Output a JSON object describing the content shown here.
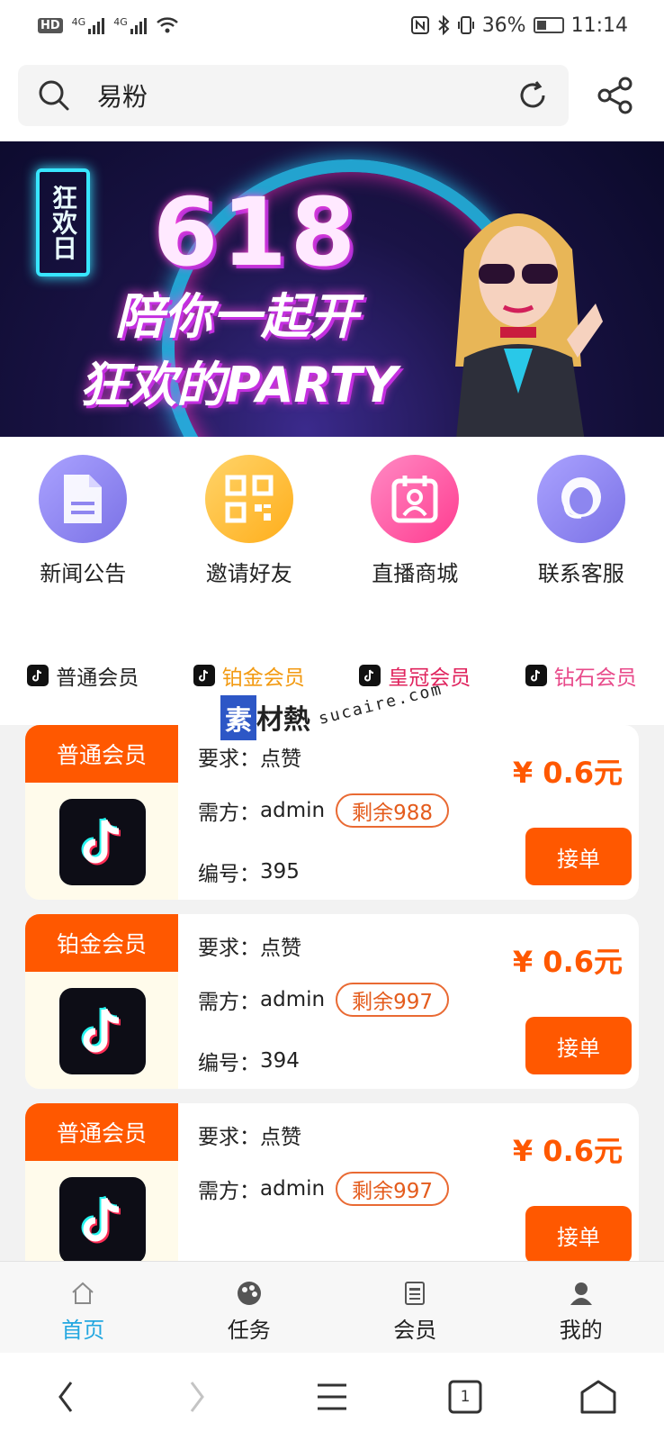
{
  "status": {
    "network1": "4G",
    "network2": "4G",
    "battery": "36%",
    "time": "11:14"
  },
  "search": {
    "text": "易粉"
  },
  "banner": {
    "sign_text": "狂欢日",
    "headline": "618",
    "line1": "陪你一起开",
    "line2": "狂欢的PARTY"
  },
  "quick_nav": [
    {
      "label": "新闻公告",
      "icon": "document-icon",
      "color": "#8f86f0"
    },
    {
      "label": "邀请好友",
      "icon": "qr-code-icon",
      "color": "#ffc03a"
    },
    {
      "label": "直播商城",
      "icon": "calendar-user-icon",
      "color": "#ff5fa8"
    },
    {
      "label": "联系客服",
      "icon": "customer-service-icon",
      "color": "#8d86ef"
    }
  ],
  "tiers": [
    {
      "label": "普通会员",
      "color": "#222222"
    },
    {
      "label": "铂金会员",
      "color": "#f29a12"
    },
    {
      "label": "皇冠会员",
      "color": "#e0245e"
    },
    {
      "label": "钻石会员",
      "color": "#e84a8a"
    }
  ],
  "watermark": {
    "cn": "素材熱",
    "box": "素",
    "rest": "材熱",
    "url": "sucaire.com"
  },
  "tasks": [
    {
      "tag": "普通会员",
      "requirement_label": "要求：",
      "requirement": "点赞",
      "requester_label": "需方：",
      "requester": "admin",
      "remaining": "剩余988",
      "id_label": "编号：",
      "id": "395",
      "price": "¥ 0.6元",
      "action": "接单"
    },
    {
      "tag": "铂金会员",
      "requirement_label": "要求：",
      "requirement": "点赞",
      "requester_label": "需方：",
      "requester": "admin",
      "remaining": "剩余997",
      "id_label": "编号：",
      "id": "394",
      "price": "¥ 0.6元",
      "action": "接单"
    },
    {
      "tag": "普通会员",
      "requirement_label": "要求：",
      "requirement": "点赞",
      "requester_label": "需方：",
      "requester": "admin",
      "remaining": "剩余997",
      "id_label": "编号：",
      "id": "",
      "price": "¥ 0.6元",
      "action": "接单"
    }
  ],
  "tabs": [
    {
      "label": "首页",
      "icon": "home-icon",
      "active": true
    },
    {
      "label": "任务",
      "icon": "palette-icon",
      "active": false
    },
    {
      "label": "会员",
      "icon": "member-card-icon",
      "active": false
    },
    {
      "label": "我的",
      "icon": "user-icon",
      "active": false
    }
  ],
  "system_nav": {
    "tab_count": "1"
  },
  "colors": {
    "accent": "#ff5800",
    "active_tab": "#23a7e0",
    "list_bg": "#f2f2f2"
  }
}
